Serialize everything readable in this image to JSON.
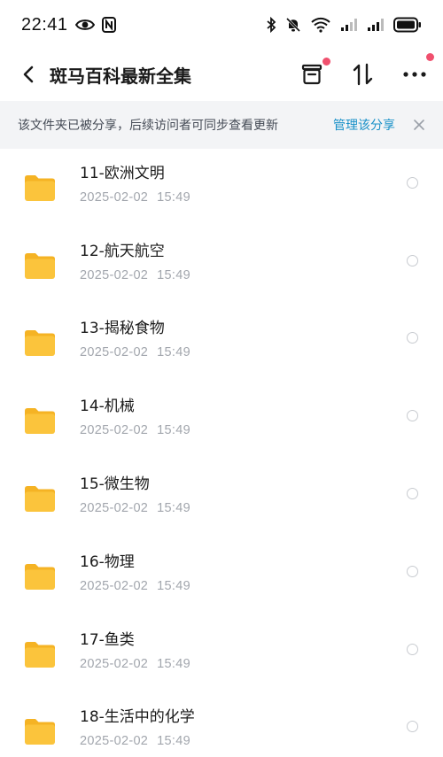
{
  "status_bar": {
    "time": "22:41",
    "icons": [
      "eye-icon",
      "nfc-icon",
      "bluetooth-icon",
      "mute-icon",
      "wifi-icon",
      "signal-icon",
      "signal-icon-2",
      "battery-icon"
    ]
  },
  "header": {
    "title": "斑马百科最新全集",
    "actions": [
      "archive-icon",
      "sort-icon",
      "more-icon"
    ]
  },
  "share_banner": {
    "text": "该文件夹已被分享，后续访问者可同步查看更新",
    "link_label": "管理该分享"
  },
  "colors": {
    "accent": "#1890c8",
    "badge": "#f0506e",
    "folder": "#fbc43c",
    "folder_tab": "#f5b324"
  },
  "items": [
    {
      "name": "11-欧洲文明",
      "date": "2025-02-02",
      "time": "15:49"
    },
    {
      "name": "12-航天航空",
      "date": "2025-02-02",
      "time": "15:49"
    },
    {
      "name": "13-揭秘食物",
      "date": "2025-02-02",
      "time": "15:49"
    },
    {
      "name": "14-机械",
      "date": "2025-02-02",
      "time": "15:49"
    },
    {
      "name": "15-微生物",
      "date": "2025-02-02",
      "time": "15:49"
    },
    {
      "name": "16-物理",
      "date": "2025-02-02",
      "time": "15:49"
    },
    {
      "name": "17-鱼类",
      "date": "2025-02-02",
      "time": "15:49"
    },
    {
      "name": "18-生活中的化学",
      "date": "2025-02-02",
      "time": "15:49"
    }
  ]
}
